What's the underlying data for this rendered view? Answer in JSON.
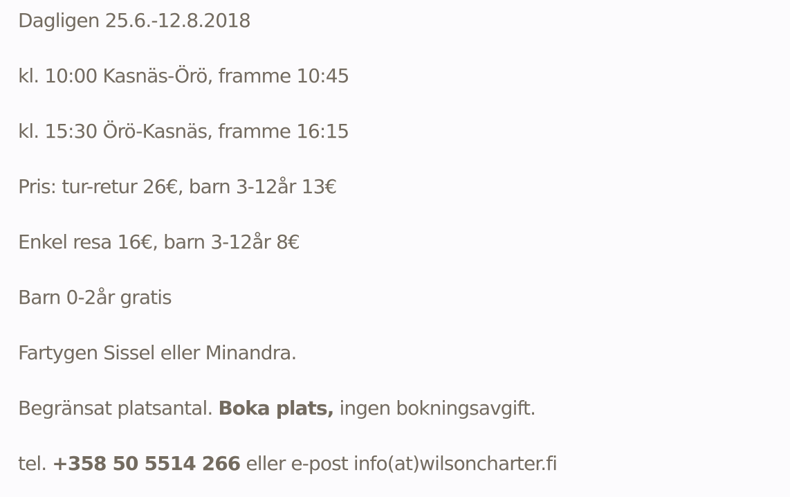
{
  "schedule": {
    "period": "Dagligen 25.6.-12.8.2018",
    "departure_out": "kl. 10:00 Kasnäs-Örö, framme 10:45",
    "departure_back": "kl. 15:30 Örö-Kasnäs, framme 16:15",
    "price_return": "Pris: tur-retur 26€, barn 3-12år 13€",
    "price_single": "Enkel resa 16€, barn 3-12år 8€",
    "price_free": "Barn 0-2år gratis",
    "vessels": "Fartygen Sissel eller Minandra."
  },
  "booking": {
    "prefix": "Begränsat platsantal. ",
    "link": "Boka plats,",
    "suffix": " ingen bokningsavgift."
  },
  "contact": {
    "tel_prefix": "tel. ",
    "phone": "+358 50 5514 266",
    "email_text": " eller e-post info(at)wilsoncharter.fi"
  }
}
